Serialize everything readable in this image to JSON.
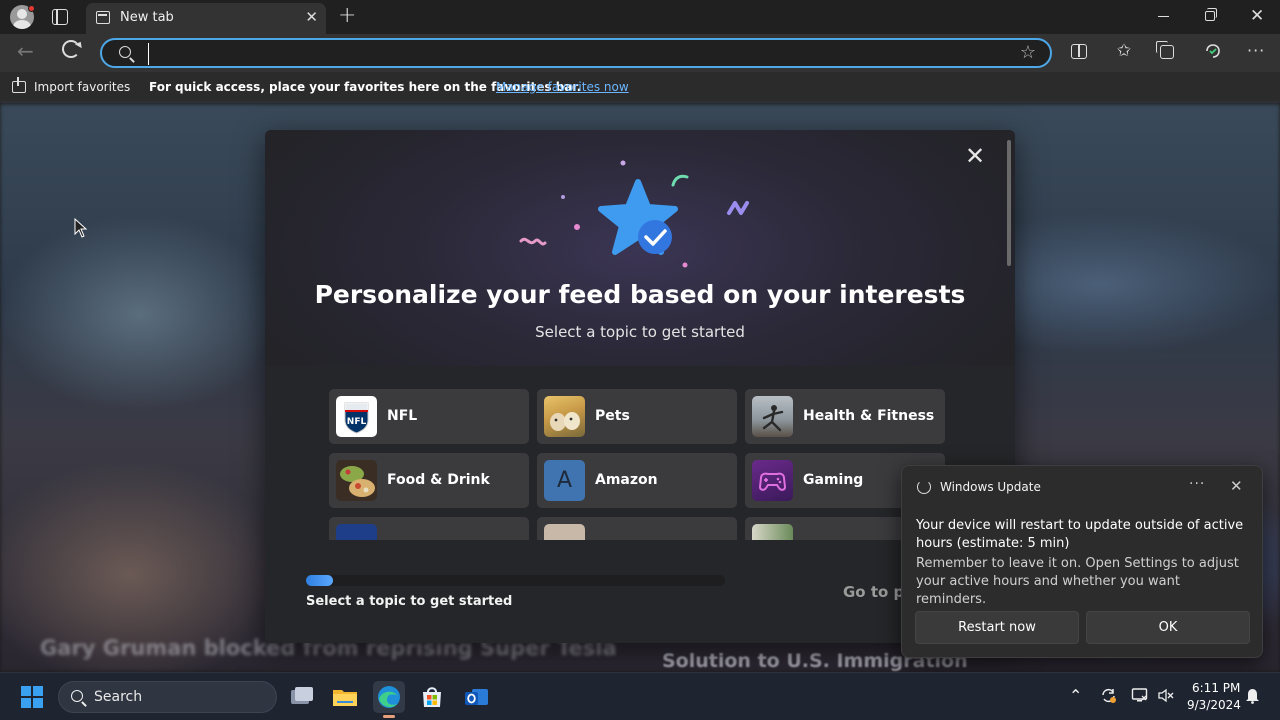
{
  "browser": {
    "tab_title": "New tab",
    "address_placeholder": "",
    "favorites_bar": {
      "import_label": "Import favorites",
      "message": "For quick access, place your favorites here on the favorites bar.",
      "manage_link": "Manage favorites now"
    }
  },
  "background_headlines": {
    "left": "Gary Gruman blocked from reprising Super Tesla",
    "right": "Solution to U.S. Immigration"
  },
  "modal": {
    "title": "Personalize your feed based on your interests",
    "subtitle": "Select a topic to get started",
    "topics": [
      {
        "label": "NFL",
        "icon": "nfl-logo"
      },
      {
        "label": "Pets",
        "icon": "pets-photo"
      },
      {
        "label": "Health & Fitness",
        "icon": "fitness-photo"
      },
      {
        "label": "Food & Drink",
        "icon": "food-photo"
      },
      {
        "label": "Amazon",
        "icon": "amazon-letter",
        "letter": "A"
      },
      {
        "label": "Gaming",
        "icon": "gaming-controller"
      },
      {
        "label": "",
        "icon": "topic-7"
      },
      {
        "label": "",
        "icon": "topic-8"
      },
      {
        "label": "",
        "icon": "topic-9"
      }
    ],
    "progress_fraction": 0.065,
    "progress_label": "Select a topic to get started",
    "next_label": "Go to p"
  },
  "toast": {
    "app_name": "Windows Update",
    "more_label": "···",
    "title": "Your device will restart to update outside of active hours (estimate: 5 min)",
    "body": "Remember to leave it on. Open Settings to adjust your active hours and whether you want reminders.",
    "restart_label": "Restart now",
    "ok_label": "OK"
  },
  "taskbar": {
    "search_label": "Search",
    "time": "6:11 PM",
    "date": "9/3/2024"
  },
  "colors": {
    "accent": "#4da8e8",
    "link": "#6cb6ff",
    "progress": "#3b8cf0"
  }
}
